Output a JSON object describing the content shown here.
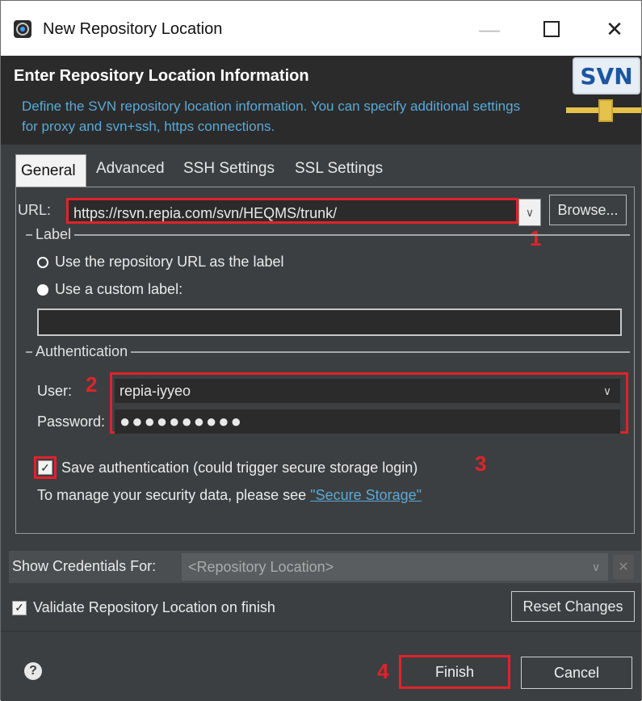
{
  "window": {
    "title": "New Repository Location",
    "minimize_glyph": "—",
    "close_glyph": "✕"
  },
  "header": {
    "title": "Enter Repository Location Information",
    "description": "Define the SVN repository location information. You can specify additional settings for proxy and svn+ssh, https connections.",
    "logo_text": "SVN"
  },
  "tabs": [
    {
      "label": "General",
      "active": true
    },
    {
      "label": "Advanced",
      "active": false
    },
    {
      "label": "SSH Settings",
      "active": false
    },
    {
      "label": "SSL Settings",
      "active": false
    }
  ],
  "url": {
    "label": "URL:",
    "value": "https://rsvn.repia.com/svn/HEQMS/trunk/",
    "browse_label": "Browse..."
  },
  "label_group": {
    "title": "Label",
    "option_repo": "Use the repository URL as the label",
    "option_custom": "Use a custom label:",
    "custom_value": ""
  },
  "auth_group": {
    "title": "Authentication",
    "user_label": "User:",
    "user_value": "repia-iyyeo",
    "password_label": "Password:",
    "password_value": "●●●●●●●●●●",
    "save_auth_label": "Save authentication (could trigger secure storage login)",
    "save_auth_checked": true,
    "manage_text": "To manage your security data, please see",
    "secure_storage_link": "\"Secure Storage\""
  },
  "credentials": {
    "label": "Show Credentials For:",
    "value": "<Repository Location>",
    "delete_glyph": "✕"
  },
  "validate": {
    "label": "Validate Repository Location on finish",
    "checked": true
  },
  "reset_label": "Reset Changes",
  "footer": {
    "help_glyph": "?",
    "finish_label": "Finish",
    "cancel_label": "Cancel"
  },
  "annotations": {
    "m1": "1",
    "m2": "2",
    "m3": "3",
    "m4": "4"
  },
  "colors": {
    "annotation_red": "#e0232a",
    "panel_dark": "#3c3f41",
    "link_blue": "#5aa9d8"
  }
}
